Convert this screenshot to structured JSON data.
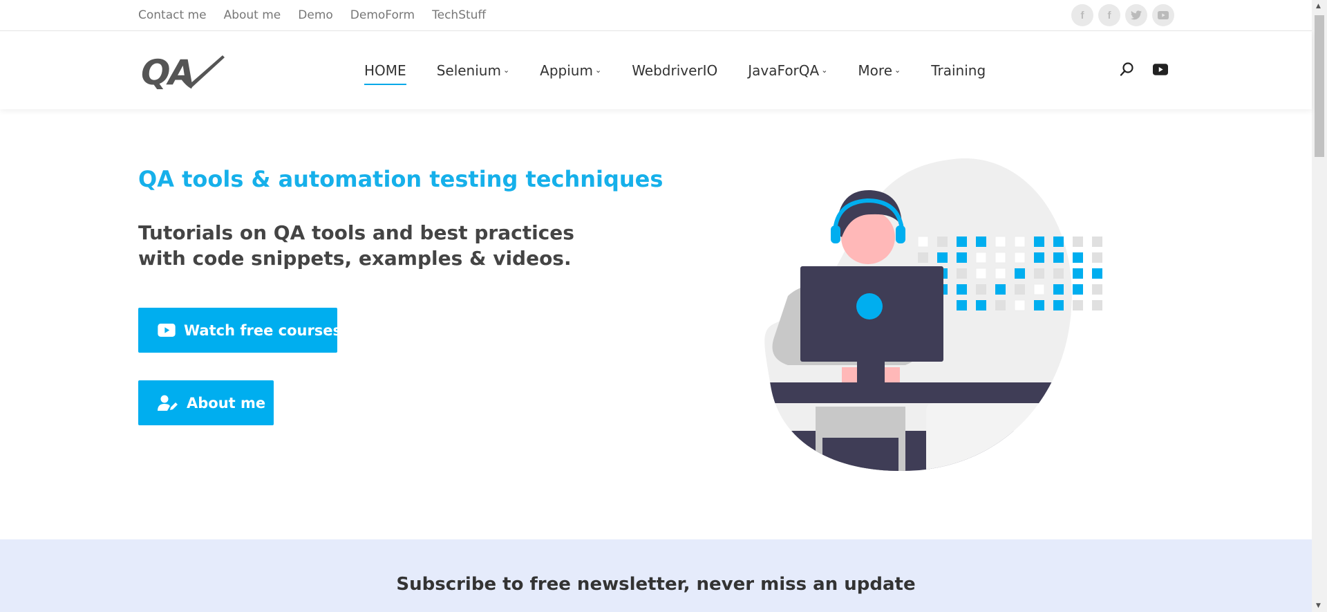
{
  "topbar": {
    "links": [
      "Contact me",
      "About me",
      "Demo",
      "DemoForm",
      "TechStuff"
    ],
    "socials": [
      {
        "icon": "facebook-icon",
        "glyph": "f"
      },
      {
        "icon": "facebook-icon",
        "glyph": "f"
      },
      {
        "icon": "twitter-icon",
        "glyph": "t"
      },
      {
        "icon": "youtube-icon",
        "glyph": "▶"
      }
    ]
  },
  "header": {
    "logo_text": "QA",
    "nav": [
      {
        "label": "HOME",
        "active": true,
        "dropdown": false
      },
      {
        "label": "Selenium",
        "active": false,
        "dropdown": true
      },
      {
        "label": "Appium",
        "active": false,
        "dropdown": true
      },
      {
        "label": "WebdriverIO",
        "active": false,
        "dropdown": false
      },
      {
        "label": "JavaForQA",
        "active": false,
        "dropdown": true
      },
      {
        "label": "More",
        "active": false,
        "dropdown": true
      },
      {
        "label": "Training",
        "active": false,
        "dropdown": false
      }
    ],
    "icons": [
      "search-icon",
      "youtube-icon"
    ]
  },
  "hero": {
    "kicker": "QA tools & automation testing techniques",
    "text": "Tutorials on QA tools and best practices with code snippets, examples & videos.",
    "buttons": {
      "courses": "Watch free courses",
      "about": "About me"
    }
  },
  "newsletter": {
    "title": "Subscribe to free newsletter, never miss an update"
  },
  "colors": {
    "accent": "#00aeef",
    "text": "#333333",
    "newsletter_bg": "#e5ebfb",
    "illustration_dark": "#3f3d56"
  }
}
